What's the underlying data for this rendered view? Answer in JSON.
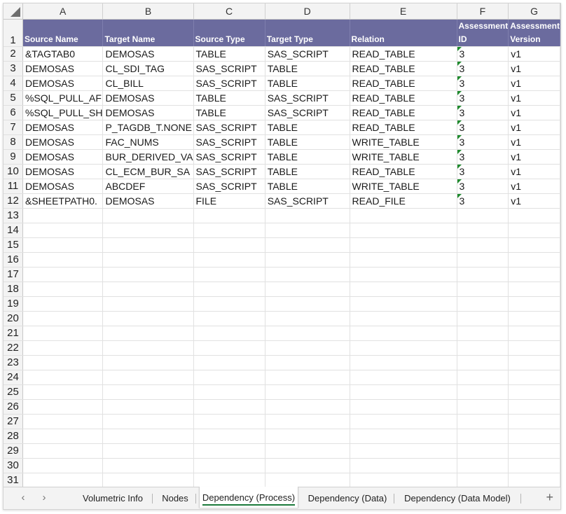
{
  "columns": [
    "A",
    "B",
    "C",
    "D",
    "E",
    "F",
    "G"
  ],
  "header_row": {
    "row_number": "1",
    "cells": [
      "Source Name",
      "Target Name",
      "Source Type",
      "Target Type",
      "Relation",
      "Assessment ID",
      "Assessment Version"
    ]
  },
  "rows": [
    {
      "n": "2",
      "cells": [
        "&TAGTAB0",
        "DEMOSAS",
        "TABLE",
        "SAS_SCRIPT",
        "READ_TABLE",
        "3",
        "v1"
      ]
    },
    {
      "n": "3",
      "cells": [
        "DEMOSAS",
        "CL_SDI_TAG",
        "SAS_SCRIPT",
        "TABLE",
        "READ_TABLE",
        "3",
        "v1"
      ]
    },
    {
      "n": "4",
      "cells": [
        "DEMOSAS",
        "CL_BILL",
        "SAS_SCRIPT",
        "TABLE",
        "READ_TABLE",
        "3",
        "v1"
      ]
    },
    {
      "n": "5",
      "cells": [
        "%SQL_PULL_AF",
        "DEMOSAS",
        "TABLE",
        "SAS_SCRIPT",
        "READ_TABLE",
        "3",
        "v1"
      ]
    },
    {
      "n": "6",
      "cells": [
        "%SQL_PULL_SH",
        "DEMOSAS",
        "TABLE",
        "SAS_SCRIPT",
        "READ_TABLE",
        "3",
        "v1"
      ]
    },
    {
      "n": "7",
      "cells": [
        "DEMOSAS",
        "P_TAGDB_T.NONE",
        "SAS_SCRIPT",
        "TABLE",
        "READ_TABLE",
        "3",
        "v1"
      ]
    },
    {
      "n": "8",
      "cells": [
        "DEMOSAS",
        "FAC_NUMS",
        "SAS_SCRIPT",
        "TABLE",
        "WRITE_TABLE",
        "3",
        "v1"
      ]
    },
    {
      "n": "9",
      "cells": [
        "DEMOSAS",
        "BUR_DERIVED_VA",
        "SAS_SCRIPT",
        "TABLE",
        "WRITE_TABLE",
        "3",
        "v1"
      ]
    },
    {
      "n": "10",
      "cells": [
        "DEMOSAS",
        "CL_ECM_BUR_SA",
        "SAS_SCRIPT",
        "TABLE",
        "READ_TABLE",
        "3",
        "v1"
      ]
    },
    {
      "n": "11",
      "cells": [
        "DEMOSAS",
        "ABCDEF",
        "SAS_SCRIPT",
        "TABLE",
        "WRITE_TABLE",
        "3",
        "v1"
      ]
    },
    {
      "n": "12",
      "cells": [
        "&SHEETPATH0.",
        "DEMOSAS",
        "FILE",
        "SAS_SCRIPT",
        "READ_FILE",
        "3",
        "v1"
      ]
    }
  ],
  "empty_row_numbers": [
    "13",
    "14",
    "15",
    "16",
    "17",
    "18",
    "19",
    "20",
    "21",
    "22",
    "23",
    "24",
    "25",
    "26",
    "27",
    "28",
    "29",
    "30",
    "31"
  ],
  "header_fill_color": "#6b6b9e",
  "number_as_text_flag_color": "#1f8a2d",
  "sheet_tabs": [
    {
      "label": "Volumetric Info",
      "active": false
    },
    {
      "label": "Nodes",
      "active": false
    },
    {
      "label": "Dependency (Process)",
      "active": true
    },
    {
      "label": "Dependency (Data)",
      "active": false
    },
    {
      "label": "Dependency (Data Model)",
      "active": false
    }
  ],
  "tab_nav": {
    "prev": "‹",
    "next": "›",
    "add": "+"
  }
}
